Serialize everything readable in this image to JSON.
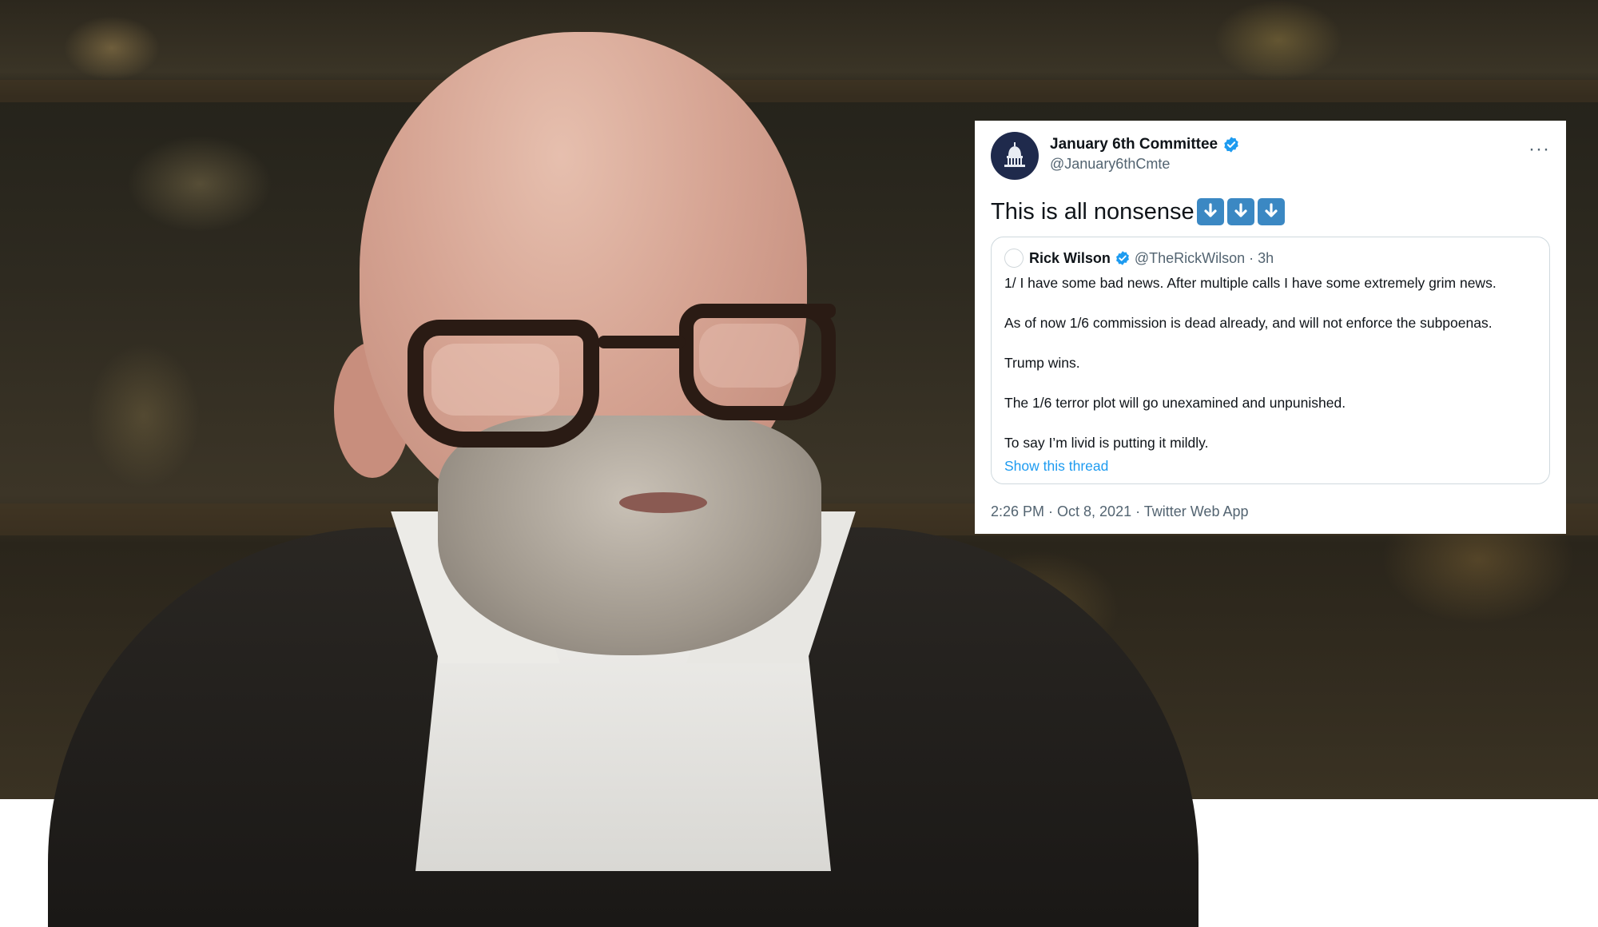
{
  "tweet": {
    "author_name": "January 6th Committee",
    "author_handle": "@January6thCmte",
    "more_label": "···",
    "text": "This is all nonsense",
    "arrow_emoji_count": 3,
    "timestamp": "2:26 PM · Oct 8, 2021 · Twitter Web App"
  },
  "quoted": {
    "author_name": "Rick Wilson",
    "handle_time": "@TheRickWilson · 3h",
    "lines": [
      "1/ I have some bad news. After multiple calls I have some extremely grim news.",
      "As of now 1/6 commission is dead already, and will not enforce the subpoenas.",
      "Trump wins.",
      "The 1/6 terror plot will go unexamined and unpunished.",
      "To say I’m livid is putting it mildly."
    ],
    "show_thread": "Show this thread"
  },
  "icons": {
    "verified": "verified-badge-icon",
    "emoji": "down-arrow-emoji-icon",
    "avatar": "capitol-dome-icon"
  },
  "colors": {
    "verified_blue": "#1d9bf0",
    "emoji_blue": "#3b88c3",
    "avatar_navy": "#1f2a4c",
    "secondary_text": "#536471"
  }
}
